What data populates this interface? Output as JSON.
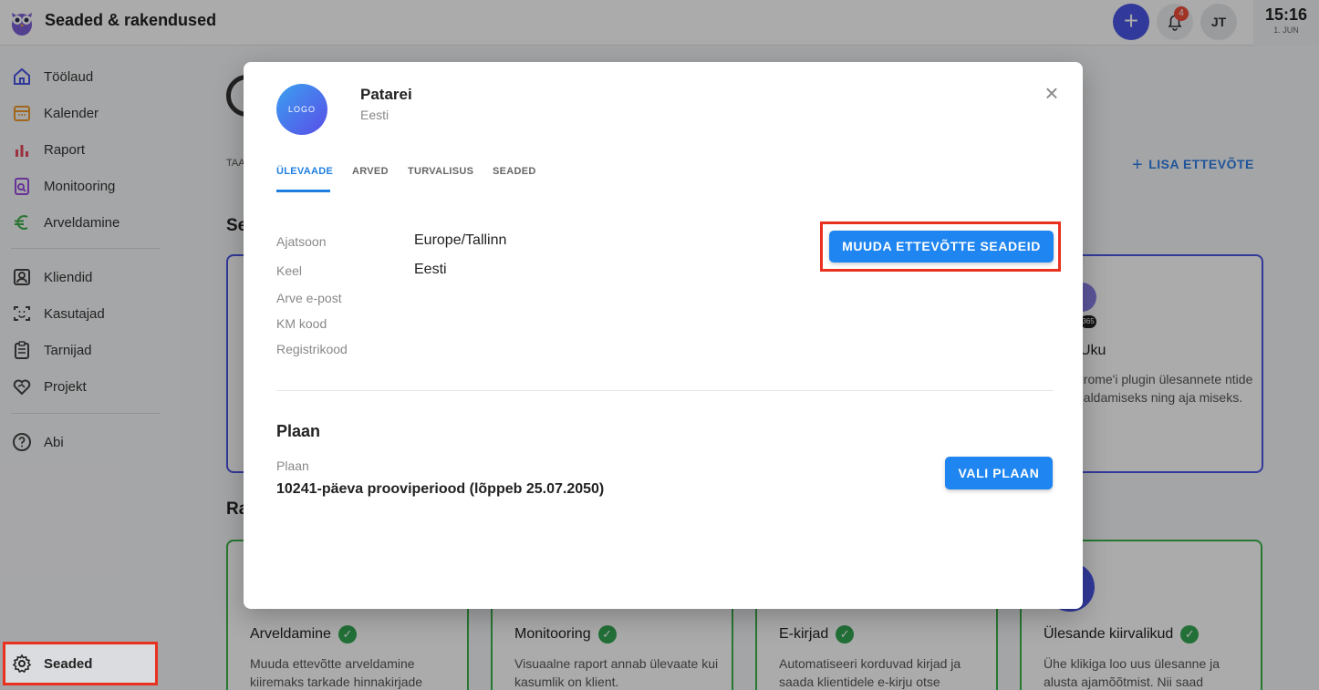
{
  "header": {
    "app_title": "Seaded & rakendused",
    "plus_icon": "+",
    "notification_count": "4",
    "avatar_initials": "JT",
    "clock_time": "15:16",
    "clock_date": "1. JUN"
  },
  "sidebar": {
    "items": [
      {
        "label": "Töölaud",
        "icon": "home-icon"
      },
      {
        "label": "Kalender",
        "icon": "calendar-icon"
      },
      {
        "label": "Raport",
        "icon": "bar-chart-icon"
      },
      {
        "label": "Monitooring",
        "icon": "monitor-doc-icon"
      },
      {
        "label": "Arveldamine",
        "icon": "euro-icon"
      },
      {
        "label": "Kliendid",
        "icon": "contact-card-icon"
      },
      {
        "label": "Kasutajad",
        "icon": "face-scan-icon"
      },
      {
        "label": "Tarnijad",
        "icon": "clipboard-icon"
      },
      {
        "label": "Projekt",
        "icon": "heart-handshake-icon"
      },
      {
        "label": "Abi",
        "icon": "help-icon"
      }
    ],
    "settings_label": "Seaded"
  },
  "background": {
    "tab_partial": "TAA",
    "section1_partial": "Se",
    "section2_partial": "Ra",
    "add_company": "LISA ETTEVÕTE",
    "uku_title": "Uku",
    "uku_badge": "365",
    "uku_text": "hrome'i plugin ülesannete ntide haldamiseks ning aja miseks.",
    "cards": [
      {
        "title": "Arveldamine",
        "desc": "Muuda ettevõtte arveldamine kiiremaks tarkade hinnakirjade"
      },
      {
        "title": "Monitooring",
        "desc": "Visuaalne raport annab ülevaate kui kasumlik on klient."
      },
      {
        "title": "E-kirjad",
        "desc": "Automatiseeri korduvad kirjad ja saada klientidele e-kirju otse"
      },
      {
        "title": "Ülesande kiirvalikud",
        "desc": "Ühe klikiga loo uus ülesanne ja alusta ajamõõtmist. Nii saad"
      }
    ]
  },
  "modal": {
    "logo_text": "LOGO",
    "company_name": "Patarei",
    "company_country": "Eesti",
    "close_icon": "×",
    "tabs": [
      "ÜLEVAADE",
      "ARVED",
      "TURVALISUS",
      "SEADED"
    ],
    "fields": [
      {
        "label": "Ajatsoon",
        "value": "Europe/Tallinn"
      },
      {
        "label": "Keel",
        "value": "Eesti"
      },
      {
        "label": "Arve e-post",
        "value": ""
      },
      {
        "label": "KM kood",
        "value": ""
      },
      {
        "label": "Registrikood",
        "value": ""
      }
    ],
    "edit_button": "MUUDA ETTEVÕTTE SEADEID",
    "plan_title": "Plaan",
    "plan_label": "Plaan",
    "plan_value": "10241-päeva prooviperiood (lõppeb 25.07.2050)",
    "choose_plan_button": "VALI PLAAN"
  },
  "colors": {
    "accent": "#1f85f0",
    "brand_purple": "#4a56e6",
    "highlight_red": "#e8321f",
    "success_green": "#34a853"
  }
}
